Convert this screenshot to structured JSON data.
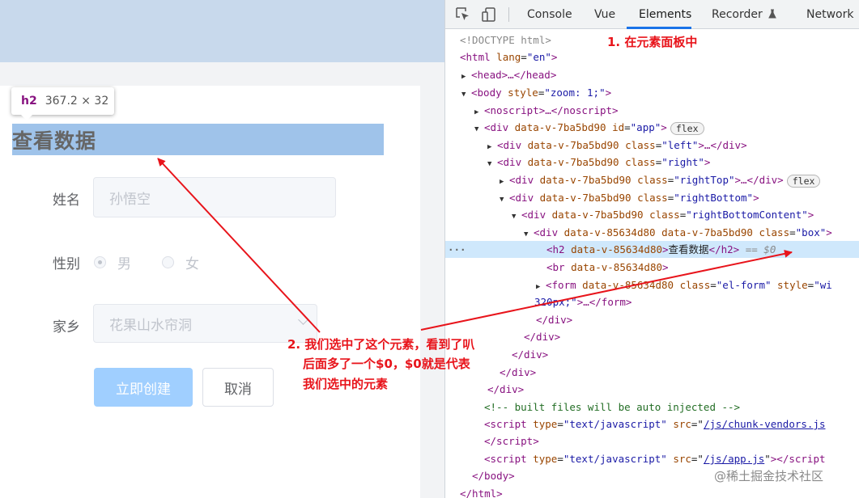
{
  "page": {
    "tooltip": {
      "tag": "h2",
      "size": "367.2 × 32"
    },
    "heading": "查看数据",
    "form": {
      "name_label": "姓名",
      "name_placeholder": "孙悟空",
      "gender_label": "性别",
      "gender_options": [
        "男",
        "女"
      ],
      "hometown_label": "家乡",
      "hometown_value": "花果山水帘洞",
      "submit_label": "立即创建",
      "cancel_label": "取消"
    }
  },
  "devtools": {
    "tabs": [
      "Console",
      "Vue",
      "Elements",
      "Recorder",
      "Network"
    ],
    "active_tab": "Elements",
    "lines": {
      "doctype": "<!DOCTYPE html>",
      "html_open": "html",
      "html_attr": "lang",
      "html_val": "\"en\"",
      "head": "<head>…</head>",
      "body_tag": "body",
      "body_attr": "style",
      "body_val": "\"zoom: 1;\"",
      "noscript": "<noscript>…</noscript>",
      "app_attr1": "data-v-7ba5bd90",
      "app_attr2": "id",
      "app_val2": "\"app\"",
      "flex_badge": "flex",
      "left_class": "\"left\"",
      "right_class": "\"right\"",
      "righttop_class": "\"rightTop\"",
      "rightbottom_class": "\"rightBottom\"",
      "rbc_class": "\"rightBottomContent\"",
      "box_attr1": "data-v-85634d80",
      "box_attr2": "data-v-7ba5bd90",
      "box_class": "\"box\"",
      "h2_text": "查看数据",
      "sel_marker": "== $0",
      "form_class": "\"el-form\"",
      "form_style_attr": "style",
      "form_style_val": "\"wi",
      "form_wrap": "320px;\"",
      "comment": "<!-- built files will be auto injected -->",
      "script_type": "\"text/javascript\"",
      "script1_src": "/js/chunk-vendors.js",
      "script2_src": "/js/app.js"
    }
  },
  "annotations": {
    "note1": "1. 在元素面板中",
    "note2_line1": "2. 我们选中了这个元素，看到了叭",
    "note2_line2": "后面多了一个$0，$0就是代表",
    "note2_line3": "我们选中的元素"
  },
  "watermark": "@稀土掘金技术社区",
  "colors": {
    "annotation_red": "#e8141b",
    "selection_blue": "#cfe8fc",
    "primary_btn": "#a0cfff"
  }
}
